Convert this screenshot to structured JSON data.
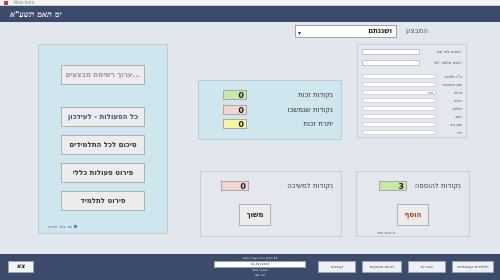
{
  "window": {
    "title": "Main form"
  },
  "header": {
    "logo": "ימ תאמ תשע\"א"
  },
  "class_selector": {
    "label": "המבצע",
    "value": "ושננתם"
  },
  "left_panel": {
    "buttons": [
      {
        "label": "ערוך רשימת מבצעים..."
      },
      {
        "label": "כל הפעולות - לעידכון"
      },
      {
        "label": "סיכום לכל התלמידים"
      },
      {
        "label": "פירוט פעולות כללי"
      },
      {
        "label": "פירוט לתלמיד"
      }
    ],
    "note": "צור ציור חידות"
  },
  "points_panel": {
    "rows": [
      {
        "label": "נקודות זכות",
        "value": "0",
        "color": "#c8e8a8"
      },
      {
        "label": "נקודות שנמשכו",
        "value": "0",
        "color": "#f4d4cc"
      },
      {
        "label": "יתרת זכות",
        "value": "0",
        "color": "#f8f4a0"
      }
    ]
  },
  "withdraw_panel": {
    "label": "נקודות למשיכה",
    "value": "0",
    "button": "משוך",
    "box_color": "#f4d4cc"
  },
  "add_panel": {
    "label": "נקודות להוספה",
    "value": "3",
    "button": "הוסף",
    "box_color": "#c8e8a8",
    "note": "ת.נחש.שזכ"
  },
  "info_panel": {
    "search_labels": [
      "חיפוש לפי שם:",
      "חפש תלמיד לפי:"
    ],
    "fields": [
      {
        "label": "ת\"ז תלמיד",
        "value": ""
      },
      {
        "label": "שם משפחה",
        "value": ""
      },
      {
        "label": "פרטי",
        "value": "אוי"
      },
      {
        "label": "כיתה",
        "value": ""
      },
      {
        "label": "טלפון",
        "value": ""
      },
      {
        "label": "ישוב",
        "value": ""
      },
      {
        "label": "שם אב",
        "value": ""
      },
      {
        "label": "נייד",
        "value": ""
      }
    ]
  },
  "footer": {
    "exit": "צא",
    "center_lines": [
      "לחלון הבא בעזרת מקש F4",
      "SQL מופעל",
      "Ver 1.0"
    ],
    "center_code": "04-8213456",
    "buttons": [
      "תלמידים קבוצתיים",
      "הגדרות",
      "דוחות מבצעים",
      "קבוצות"
    ]
  }
}
